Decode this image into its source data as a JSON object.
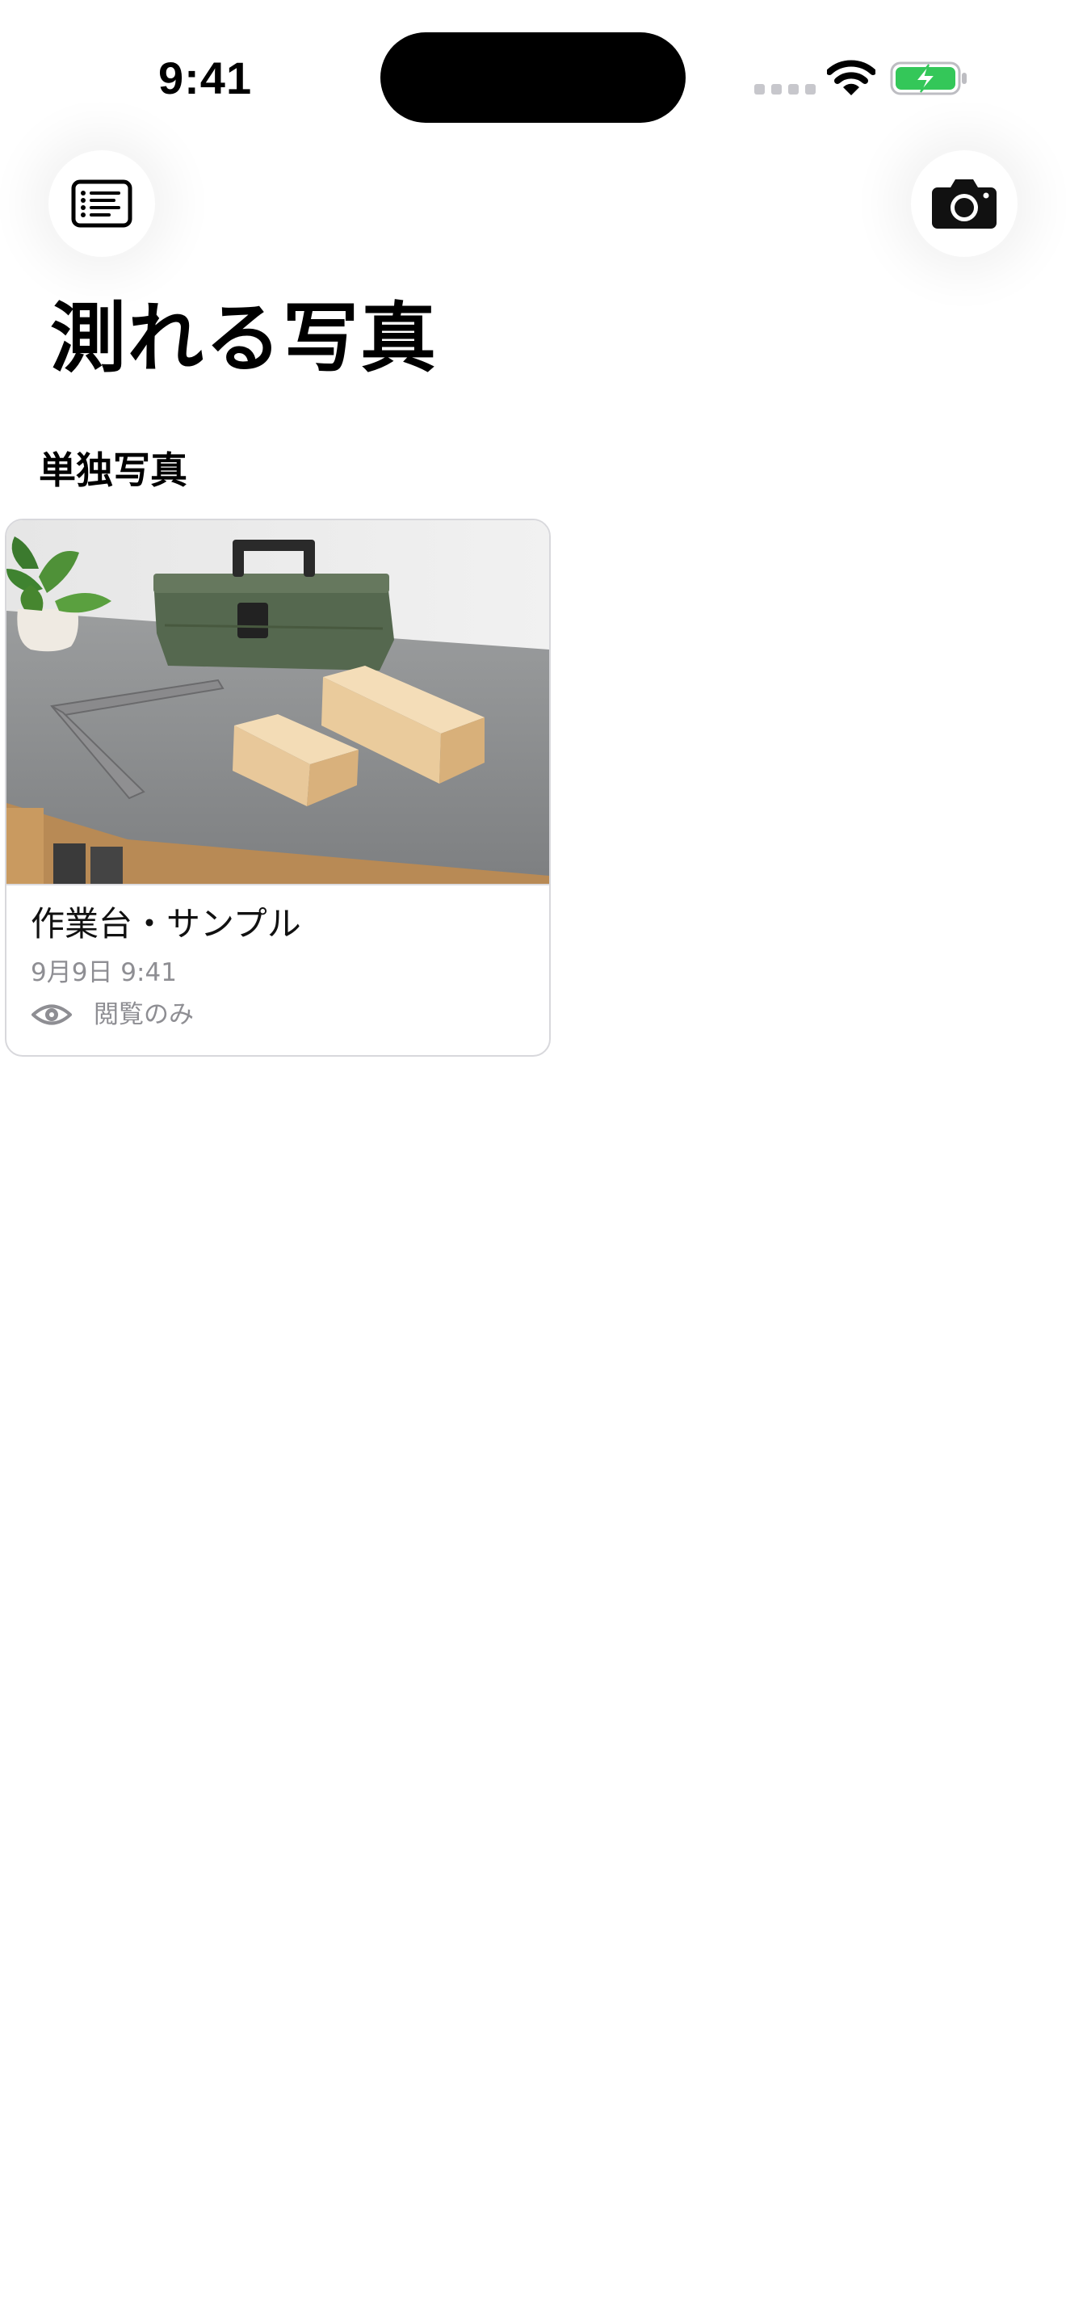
{
  "status_bar": {
    "time": "9:41",
    "icons": [
      "cellular-signal-icon",
      "wifi-icon",
      "battery-charging-icon"
    ],
    "battery_color": "#34c759"
  },
  "nav": {
    "left_icon": "list-icon",
    "right_icon": "camera-icon"
  },
  "page": {
    "title": "測れる写真"
  },
  "sections": [
    {
      "header": "単独写真",
      "items": [
        {
          "title": "作業台・サンプル",
          "date": "9月9日 9:41",
          "access_icon": "eye-icon",
          "access_label": "閲覧のみ"
        }
      ]
    }
  ],
  "colors": {
    "background": "#ffffff",
    "secondary_text": "#8e8e93",
    "card_border": "#d8d8dc"
  }
}
